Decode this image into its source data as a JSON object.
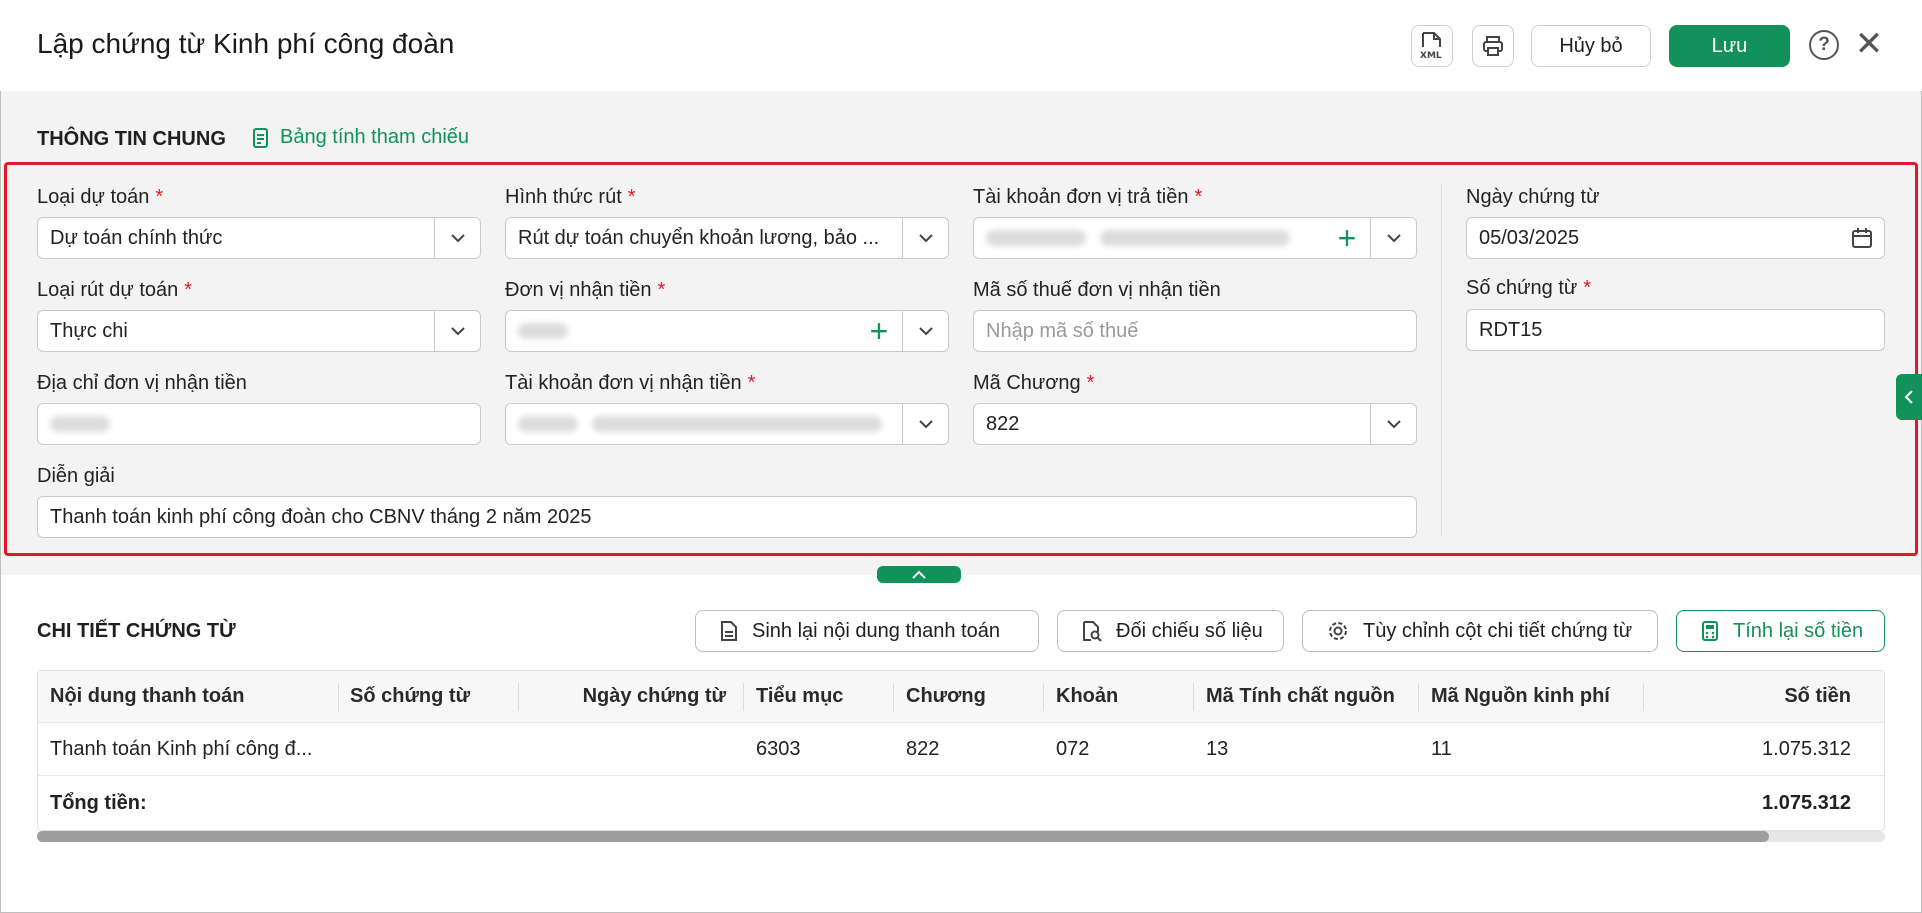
{
  "header": {
    "title": "Lập chứng từ Kinh phí công đoàn",
    "cancel_label": "Hủy bỏ",
    "save_label": "Lưu",
    "help_glyph": "?",
    "close_glyph": "✕"
  },
  "general": {
    "section_title": "THÔNG TIN CHUNG",
    "ref_link": "Bảng tính tham chiếu",
    "required_mark": "*",
    "loai_du_toan": {
      "label": "Loại dự toán",
      "value": "Dự toán chính thức"
    },
    "hinh_thuc_rut": {
      "label": "Hình thức rút",
      "value": "Rút dự toán chuyển khoản lương, bảo ..."
    },
    "tk_don_vi_tra_tien": {
      "label": "Tài khoản đơn vị trả tiền"
    },
    "ngay_chung_tu": {
      "label": "Ngày chứng từ",
      "value": "05/03/2025"
    },
    "loai_rut_du_toan": {
      "label": "Loại rút dự toán",
      "value": "Thực chi"
    },
    "don_vi_nhan_tien": {
      "label": "Đơn vị nhận tiền"
    },
    "ma_so_thue": {
      "label": "Mã số thuế đơn vị nhận tiền",
      "placeholder": "Nhập mã số thuế"
    },
    "so_chung_tu": {
      "label": "Số chứng từ",
      "value": "RDT15"
    },
    "dia_chi": {
      "label": "Địa chỉ đơn vị nhận tiền"
    },
    "tk_don_vi_nhan_tien": {
      "label": "Tài khoản đơn vị nhận tiền"
    },
    "ma_chuong": {
      "label": "Mã Chương",
      "value": "822"
    },
    "dien_giai": {
      "label": "Diễn giải",
      "value": "Thanh toán kinh phí công đoàn cho CBNV tháng 2 năm 2025"
    }
  },
  "details": {
    "section_title": "CHI TIẾT CHỨNG TỪ",
    "actions": {
      "regenerate": "Sinh lại nội dung thanh toán",
      "reconcile": "Đối chiếu số liệu",
      "customize": "Tùy chỉnh cột chi tiết chứng từ",
      "recalc": "Tính lại số tiền"
    },
    "columns": [
      "Nội dung thanh toán",
      "Số chứng từ",
      "Ngày chứng từ",
      "Tiểu mục",
      "Chương",
      "Khoản",
      "Mã Tính chất nguồn",
      "Mã Nguồn kinh phí",
      "Số tiền"
    ],
    "rows": [
      [
        "Thanh toán Kinh phí công đ...",
        "",
        "",
        "6303",
        "822",
        "072",
        "13",
        "11",
        "1.075.312"
      ]
    ],
    "total_label": "Tổng tiền:",
    "total_value": "1.075.312"
  },
  "colors": {
    "accent": "#12915b",
    "required": "#e0192a",
    "highlight_border": "#e0192a"
  }
}
